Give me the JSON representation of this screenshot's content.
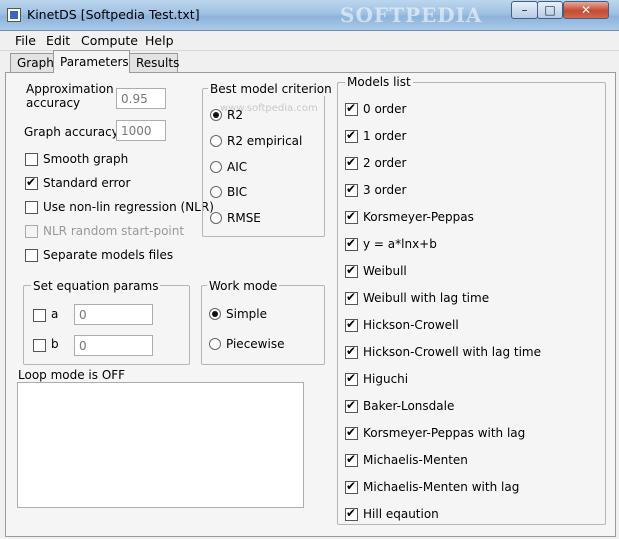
{
  "window": {
    "title": "KinetDS [Softpedia Test.txt]",
    "watermark": "SOFTPEDIA",
    "minimize": "–",
    "maximize": "□",
    "close": "✕"
  },
  "menu": [
    "File",
    "Edit",
    "Compute",
    "Help"
  ],
  "tabs": [
    {
      "label": "Graph"
    },
    {
      "label": "Parameters",
      "active": true
    },
    {
      "label": "Results"
    }
  ],
  "params": {
    "approx_label_1": "Approximation",
    "approx_label_2": "accuracy",
    "approx_value": "0.95",
    "graph_acc_label": "Graph accuracy",
    "graph_acc_value": "1000",
    "options": [
      {
        "label": "Smooth graph",
        "checked": false,
        "enabled": true
      },
      {
        "label": "Standard error",
        "checked": true,
        "enabled": true
      },
      {
        "label": "Use non-lin regression (NLR)",
        "checked": false,
        "enabled": true
      },
      {
        "label": "NLR random start-point",
        "checked": false,
        "enabled": false
      },
      {
        "label": "Separate models files",
        "checked": false,
        "enabled": true
      }
    ]
  },
  "criterion": {
    "title": "Best model criterion",
    "watermark": "www.softpedia.com",
    "options": [
      {
        "label": "R2",
        "checked": true
      },
      {
        "label": "R2 empirical",
        "checked": false
      },
      {
        "label": "AIC",
        "checked": false
      },
      {
        "label": "BIC",
        "checked": false
      },
      {
        "label": "RMSE",
        "checked": false
      }
    ]
  },
  "equation": {
    "title": "Set equation params",
    "a_label": "a",
    "a_value": "0",
    "b_label": "b",
    "b_value": "0"
  },
  "workmode": {
    "title": "Work mode",
    "options": [
      {
        "label": "Simple",
        "checked": true
      },
      {
        "label": "Piecewise",
        "checked": false
      }
    ]
  },
  "loop": {
    "label": "Loop mode is OFF"
  },
  "models": {
    "title": "Models list",
    "items": [
      {
        "label": "0 order",
        "checked": true
      },
      {
        "label": "1 order",
        "checked": true
      },
      {
        "label": "2 order",
        "checked": true
      },
      {
        "label": "3 order",
        "checked": true
      },
      {
        "label": "Korsmeyer-Peppas",
        "checked": true
      },
      {
        "label": "y = a*lnx+b",
        "checked": true
      },
      {
        "label": "Weibull",
        "checked": true
      },
      {
        "label": "Weibull with lag time",
        "checked": true
      },
      {
        "label": "Hickson-Crowell",
        "checked": true
      },
      {
        "label": "Hickson-Crowell with lag time",
        "checked": true
      },
      {
        "label": "Higuchi",
        "checked": true
      },
      {
        "label": "Baker-Lonsdale",
        "checked": true
      },
      {
        "label": "Korsmeyer-Peppas with lag",
        "checked": true
      },
      {
        "label": "Michaelis-Menten",
        "checked": true
      },
      {
        "label": "Michaelis-Menten with lag",
        "checked": true
      },
      {
        "label": "Hill eqaution",
        "checked": true
      }
    ]
  }
}
